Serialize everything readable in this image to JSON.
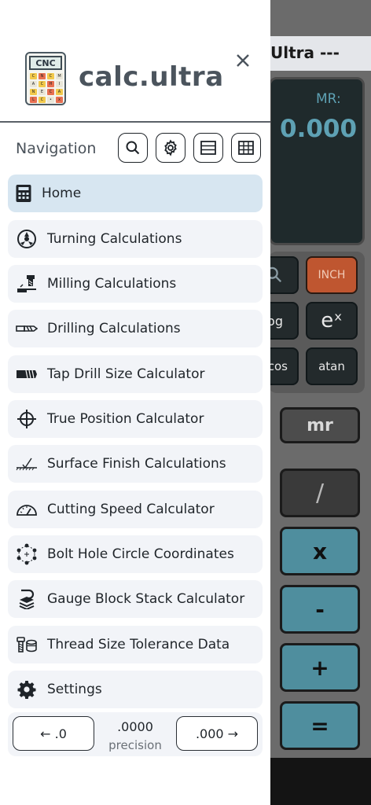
{
  "background_calculator": {
    "title_partial": "Ultra ---",
    "memory_label": "MR:",
    "display_value": "0.000",
    "keys": {
      "search": "🔍",
      "unit": "INCH",
      "log_partial": "og",
      "exp": "eˣ",
      "cos_partial": "cos",
      "atan": "atan",
      "mr": "mr",
      "divide": "/",
      "multiply": "x",
      "minus": "-",
      "plus": "+",
      "equals": "="
    },
    "colors": {
      "display_text": "#5ea1b4",
      "unit_key": "#bf5630",
      "operator_key": "#4f8e9e"
    }
  },
  "drawer": {
    "logo": {
      "top_text": "CNC",
      "grid_letters": [
        "C",
        "N",
        "C",
        "M",
        "A",
        "C",
        "H",
        "I",
        "N",
        "E",
        "C",
        "A",
        "L",
        "C",
        "•",
        "x"
      ]
    },
    "brand": "calc.ultra",
    "close_icon": "×",
    "nav_heading": "Navigation",
    "tools": [
      "search-icon",
      "gear-icon",
      "list-view-icon",
      "grid-view-icon"
    ],
    "menu": [
      {
        "label": "Home",
        "icon": "calculator-icon"
      },
      {
        "label": "Turning Calculations",
        "icon": "turning-icon"
      },
      {
        "label": "Milling Calculations",
        "icon": "milling-icon"
      },
      {
        "label": "Drilling Calculations",
        "icon": "drill-bit-icon"
      },
      {
        "label": "Tap Drill Size Calculator",
        "icon": "tap-icon"
      },
      {
        "label": "True Position Calculator",
        "icon": "crosshair-icon"
      },
      {
        "label": "Surface Finish Calculations",
        "icon": "surface-finish-icon"
      },
      {
        "label": "Cutting Speed Calculator",
        "icon": "speedometer-icon"
      },
      {
        "label": "Bolt Hole Circle Coordinates",
        "icon": "bolt-circle-icon"
      },
      {
        "label": "Gauge Block Stack Calculator",
        "icon": "gauge-block-icon"
      },
      {
        "label": "Thread Size Tolerance Data",
        "icon": "thread-icon"
      },
      {
        "label": "Settings",
        "icon": "gear-icon"
      }
    ],
    "active_item": "Home",
    "precision": {
      "decrease_label": "← .0",
      "value": ".0000",
      "label": "precision",
      "increase_label": ".000 →"
    }
  }
}
